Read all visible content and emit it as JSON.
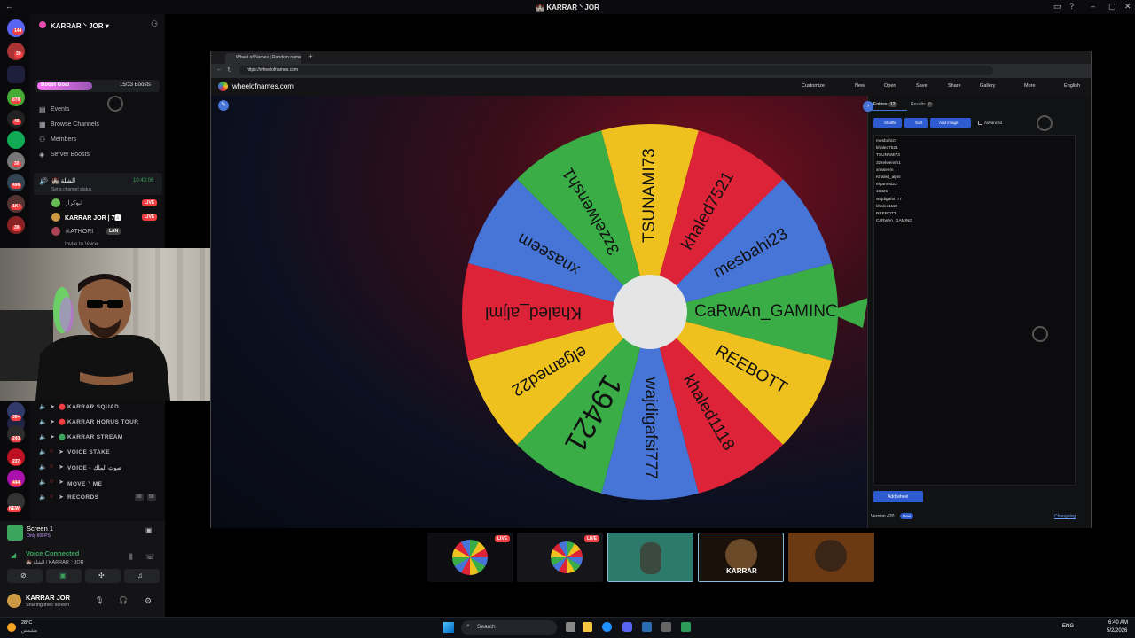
{
  "window": {
    "title": "KARRAR ⸌ JOR",
    "title_emoji": "🏰"
  },
  "server_rail": {
    "badges": [
      "144",
      "39",
      "878",
      "40",
      "30",
      "496",
      "1K+",
      "39",
      "28",
      "39+",
      "243",
      "237",
      "444",
      "NEW"
    ]
  },
  "channel_panel": {
    "server_name": "KARRAR ⸌ JOR",
    "boost_goal_label": "Boost Goal",
    "boost_count": "15/33 Boosts",
    "links": [
      "Events",
      "Browse Channels",
      "Members",
      "Server Boosts"
    ],
    "voice_channel": {
      "name": "الشلة",
      "time": "10:43:06",
      "status_placeholder": "Set a channel status",
      "members": [
        {
          "name": "ابوكرار",
          "live": "LIVE"
        },
        {
          "name": "KARRAR JOR | 7🅰",
          "live": "LIVE"
        },
        {
          "name": "ATHORI",
          "tag": "LAN"
        }
      ],
      "invite_label": "Invite to Voice"
    },
    "channels": [
      {
        "name": "KARRAR SQUAD"
      },
      {
        "name": "KARRAR HORUS TOUR"
      },
      {
        "name": "KARRAR STREAM"
      },
      {
        "name": "VOICE STAKE"
      },
      {
        "name": "VOICE - صوت الملك"
      },
      {
        "name": "MOVE ⸌ ME"
      },
      {
        "name": "RECORDS",
        "count_a": "00",
        "count_b": "99"
      }
    ]
  },
  "screen_share": {
    "title": "Screen 1",
    "subtitle": "Only 60FPS",
    "voice_connected": "Voice Connected",
    "voice_location": "🏰 الشلة / KARRAR ⸌ JOR"
  },
  "user": {
    "name": "KARRAR JOR",
    "status": "Sharing their screen"
  },
  "browser": {
    "tab_title": "Wheel of Names | Random name",
    "url": "https://wheelofnames.com",
    "site_name": "wheelofnames.com",
    "nav": [
      "Customize",
      "New",
      "Open",
      "Save",
      "Share",
      "Gallery",
      "More",
      "English"
    ],
    "tabs": [
      {
        "label": "Entries",
        "count": "12"
      },
      {
        "label": "Results",
        "count": "0"
      }
    ],
    "panel_buttons": [
      "Shuffle",
      "Sort",
      "Add image"
    ],
    "advanced_label": "Advanced",
    "entries": [
      "mesbahi23",
      "khaled7521",
      "TSUNAMI73",
      "3zzelwensh1",
      "xnaseem",
      "Khaled_aljml",
      "elgamed22",
      "19421",
      "wajdigafsi777",
      "khaled1118",
      "REEBOTT",
      "CaRwAn_GAMING"
    ],
    "add_wheel": "Add wheel",
    "version": "Version 420",
    "version_badge": "New",
    "changelog": "Changelog"
  },
  "wheel": {
    "segments": [
      {
        "label": "CaRwAn_GAMING",
        "color": "#3aad46"
      },
      {
        "label": "REEBOTT",
        "color": "#efc11f"
      },
      {
        "label": "khaled1118",
        "color": "#dd2337"
      },
      {
        "label": "wajdigafsi777",
        "color": "#4675d7"
      },
      {
        "label": "19421",
        "color": "#3aad46"
      },
      {
        "label": "elgamed22",
        "color": "#efc11f"
      },
      {
        "label": "Khaled_aljml",
        "color": "#dd2337"
      },
      {
        "label": "xnaseem",
        "color": "#4675d7"
      },
      {
        "label": "3zzelwensh1",
        "color": "#3aad46"
      },
      {
        "label": "TSUNAMI73",
        "color": "#efc11f"
      },
      {
        "label": "khaled7521",
        "color": "#dd2337"
      },
      {
        "label": "mesbahi23",
        "color": "#4675d7"
      }
    ]
  },
  "thumbnails": [
    {
      "live": "LIVE"
    },
    {
      "live": "LIVE"
    },
    {
      "label": ""
    },
    {
      "label": "KARRAR"
    },
    {
      "label": ""
    }
  ],
  "taskbar": {
    "weather_temp": "28°C",
    "weather_text": "مشمس",
    "search_placeholder": "Search",
    "lang": "ENG",
    "time": "6:40 AM",
    "date": "5/2/2026"
  }
}
